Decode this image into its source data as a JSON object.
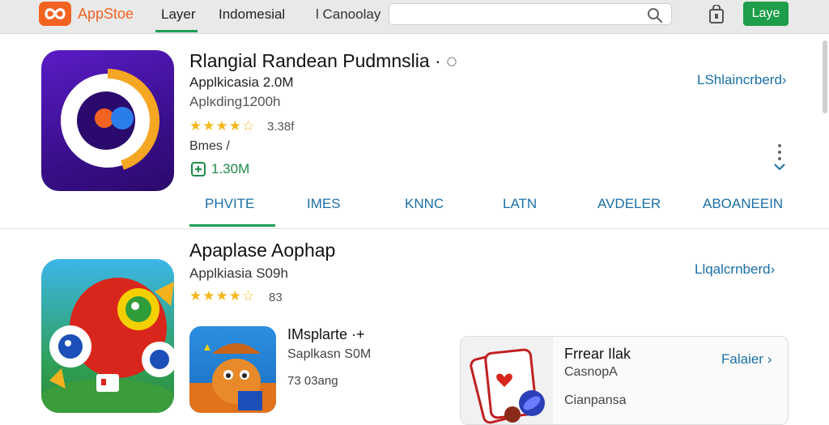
{
  "topbar": {
    "brand": "AppStoe",
    "nav": [
      "Layer",
      "Indomesial",
      "l Canoolay"
    ],
    "search_placeholder": "",
    "button_label": "Laye",
    "colors": {
      "brand": "#f26322",
      "accent": "#1e9e4a",
      "link": "#1a6fa8"
    }
  },
  "featured": {
    "title": "Rlangial Randean Pudmnslia · ◌",
    "subtitle": "Applkicasia 2.0M",
    "subtitle2": "Aplĸding1200h",
    "rating_stars": "★★★★☆",
    "rating_count": "3.38f",
    "meta": "Bmes /",
    "size": "1.30M",
    "link": "LShlaincrberd",
    "icon": "featured-app-icon",
    "tabs": [
      "PHVITE",
      "IMES",
      "KNNC",
      "LATN",
      "AVDELER",
      "ABOANEEIN"
    ]
  },
  "second": {
    "title": "Apaplase Aophap",
    "subtitle": "Applkiasia S09h",
    "rating_stars": "★★★★☆",
    "rating_count": "83",
    "link": "Llqalcrnberd",
    "icon": "bird-game-icon",
    "mini": {
      "title": "IMsplarte ·+",
      "subtitle": "Saplkasn S0M",
      "meta": "73 03ang"
    },
    "card": {
      "title": "Frrear Ilak",
      "subtitle": "CasnopA",
      "meta": "Cianpansa",
      "link": "Falaier"
    }
  }
}
